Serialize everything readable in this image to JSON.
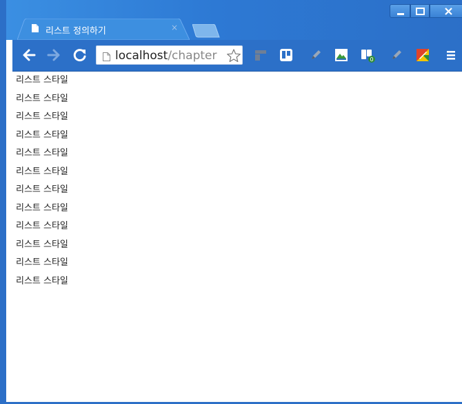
{
  "tab": {
    "title": "리스트 정의하기",
    "close_glyph": "×",
    "favicon": "document-icon"
  },
  "window_controls": {
    "minimize": "minimize-icon",
    "maximize": "maximize-icon",
    "close": "close-icon"
  },
  "toolbar": {
    "back": "back-arrow-icon",
    "forward": "forward-arrow-icon",
    "reload": "reload-icon",
    "url_host": "localhost",
    "url_path": "/chapter",
    "bookmark": "star-icon",
    "extensions": [
      "extension-bars-icon",
      "trello-icon",
      "pencil-icon",
      "image-extension-icon",
      "extension-badge-icon",
      "pencil-icon",
      "colorful-extension-icon"
    ],
    "menu": "hamburger-menu-icon"
  },
  "content": {
    "items": [
      "리스트 스타일",
      "리스트 스타일",
      "리스트 스타일",
      "리스트 스타일",
      "리스트 스타일",
      "리스트 스타일",
      "리스트 스타일",
      "리스트 스타일",
      "리스트 스타일",
      "리스트 스타일",
      "리스트 스타일",
      "리스트 스타일"
    ]
  },
  "colors": {
    "chrome_blue": "#2c70c8",
    "tab_blue": "#3b8fe2",
    "text": "#222222"
  }
}
